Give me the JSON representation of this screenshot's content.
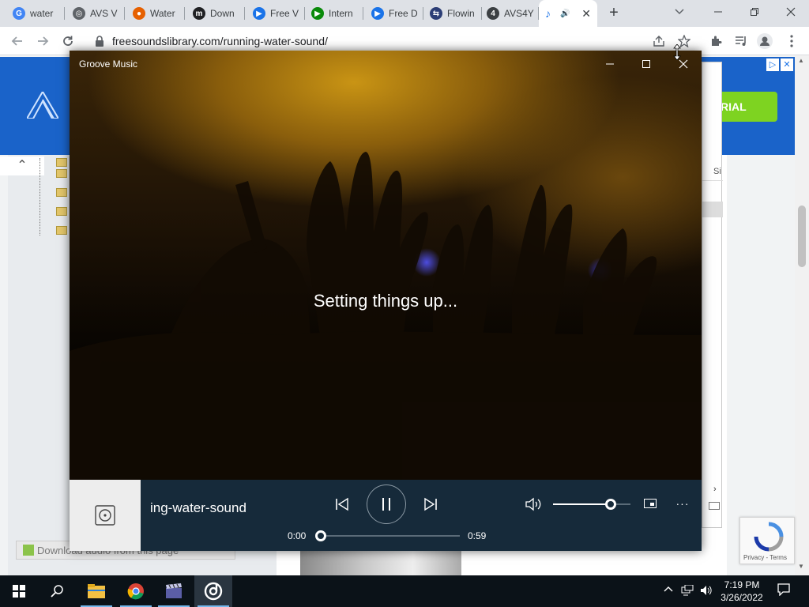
{
  "browser": {
    "tabs": [
      {
        "label": "water",
        "icon": "google-icon",
        "color": "#4285f4",
        "glyph": "G"
      },
      {
        "label": "AVS V",
        "icon": "avs-icon",
        "color": "#5f6368",
        "glyph": "◎"
      },
      {
        "label": "Water",
        "icon": "firefox-icon",
        "color": "#e66000",
        "glyph": "●"
      },
      {
        "label": "Down",
        "icon": "m-icon",
        "color": "#202124",
        "glyph": "m"
      },
      {
        "label": "Free V",
        "icon": "play-circle-icon",
        "color": "#1a73e8",
        "glyph": "▶"
      },
      {
        "label": "Intern",
        "icon": "green-play-icon",
        "color": "#0a8a0a",
        "glyph": "▶"
      },
      {
        "label": "Free D",
        "icon": "play-circle-icon",
        "color": "#1a73e8",
        "glyph": "▶"
      },
      {
        "label": "Flowin",
        "icon": "arrows-icon",
        "color": "#2c3e76",
        "glyph": "⇆"
      },
      {
        "label": "AVS4Y",
        "icon": "avs4you-icon",
        "color": "#3c4043",
        "glyph": "4"
      }
    ],
    "active_tab": {
      "icon": "music-note-icon",
      "glyph": "♪",
      "audio_glyph": "🔊",
      "close": "✕"
    },
    "new_tab": "+",
    "url": "freesoundslibrary.com/running-water-sound/"
  },
  "page": {
    "ad_cta": "RIAL",
    "ad_help": "?",
    "ad_close": "✕",
    "collapse_glyph": "⌃",
    "download_button": "Download audio from this page",
    "side_text": "Si",
    "recaptcha_terms": "Privacy - Terms"
  },
  "groove": {
    "window_title": "Groove Music",
    "status": "Setting things up...",
    "track_title": "ing-water-sound",
    "time_elapsed": "0:00",
    "time_total": "0:59",
    "progress": 0.0,
    "volume": 0.74,
    "more_glyph": "···"
  },
  "taskbar": {
    "time": "7:19 PM",
    "date": "3/26/2022"
  },
  "colors": {
    "groove_player_bg": "#162a3a",
    "ad_bg": "#1a63c9",
    "ad_cta": "#7ed321",
    "taskbar_bg": "#0b1218"
  }
}
